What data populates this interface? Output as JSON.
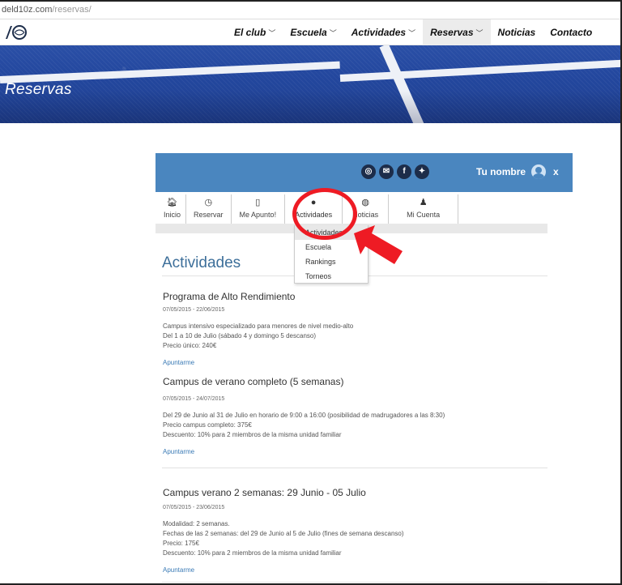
{
  "browser": {
    "url_host": "deld10z.com",
    "url_path": "/reservas/"
  },
  "nav": {
    "items": [
      {
        "label": "El club",
        "dropdown": true
      },
      {
        "label": "Escuela",
        "dropdown": true
      },
      {
        "label": "Actividades",
        "dropdown": true
      },
      {
        "label": "Reservas",
        "dropdown": true
      },
      {
        "label": "Noticias",
        "dropdown": false
      },
      {
        "label": "Contacto",
        "dropdown": false
      }
    ]
  },
  "hero": {
    "title": "Reservas"
  },
  "panel": {
    "social": [
      "instagram-icon",
      "mail-icon",
      "facebook-icon",
      "twitter-icon"
    ],
    "user_name": "Tu nombre",
    "close_label": "x"
  },
  "tabs": [
    {
      "label": "Inicio",
      "icon": "home-icon"
    },
    {
      "label": "Reservar",
      "icon": "clock-icon"
    },
    {
      "label": "Me Apunto!",
      "icon": "clipboard-icon"
    },
    {
      "label": "Actividades",
      "icon": "ball-icon"
    },
    {
      "label": "Noticias",
      "icon": "globe-icon"
    },
    {
      "label": "Mi Cuenta",
      "icon": "user-icon"
    }
  ],
  "dropdown": {
    "items": [
      "Actividades",
      "Escuela",
      "Rankings",
      "Torneos"
    ]
  },
  "main": {
    "title": "Actividades",
    "activities": [
      {
        "title": "Programa de Alto Rendimiento",
        "dates": "07/05/2015 - 22/06/2015",
        "lines": [
          "Campus intensivo especializado para menores de nivel medio-alto",
          "Del 1 a 10 de Julio (sábado 4 y domingo 5 descanso)",
          "Precio único: 240€"
        ],
        "link": "Apuntarme"
      },
      {
        "title": "Campus de verano completo (5 semanas)",
        "dates": "07/05/2015 - 24/07/2015",
        "lines": [
          "Del 29 de Junio al 31 de Julio en horario de 9:00 a 16:00 (posibilidad de madrugadores a las 8:30)",
          "Precio campus completo: 375€",
          "Descuento: 10% para 2 miembros de la misma unidad familiar"
        ],
        "link": "Apuntarme"
      },
      {
        "title": "Campus verano 2 semanas: 29 Junio - 05 Julio",
        "dates": "07/05/2015 - 23/06/2015",
        "lines": [
          "Modalidad: 2 semanas.",
          "Fechas de las 2 semanas: del 29 de Junio al 5 de Julio (fines de semana descanso)",
          "Precio: 175€",
          "Descuento: 10% para 2 miembros de la misma unidad familiar"
        ],
        "link": "Apuntarme"
      }
    ]
  },
  "colors": {
    "panel": "#4a86bf",
    "accent": "#3d6f9a",
    "annotation": "#ee1b24"
  }
}
